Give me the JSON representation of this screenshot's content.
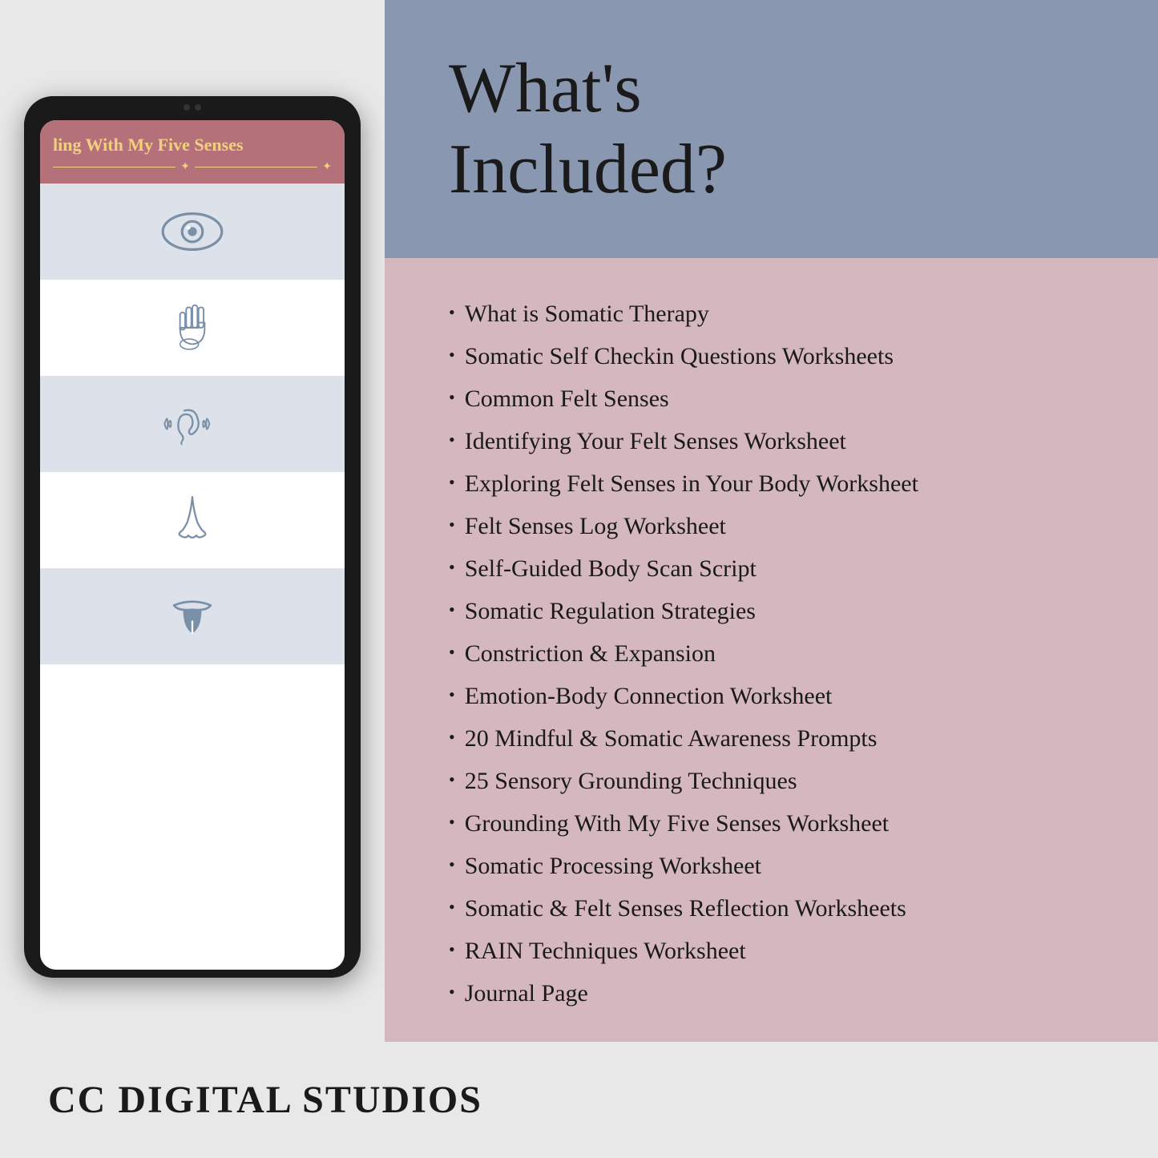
{
  "left": {
    "tablet": {
      "screen_title": "ling With My Five Senses",
      "senses": [
        "eye",
        "hand",
        "ear",
        "nose",
        "tongue"
      ]
    }
  },
  "right": {
    "header": {
      "title_line1": "What's",
      "title_line2": "Included?"
    },
    "items": [
      "What is Somatic Therapy",
      "Somatic Self Checkin Questions Worksheets",
      "Common Felt Senses",
      "Identifying Your Felt Senses Worksheet",
      "Exploring Felt Senses in Your Body Worksheet",
      "Felt Senses Log Worksheet",
      "Self-Guided Body Scan Script",
      "Somatic Regulation Strategies",
      "Constriction & Expansion",
      "Emotion-Body Connection Worksheet",
      "20 Mindful & Somatic Awareness Prompts",
      "25 Sensory Grounding Techniques",
      "Grounding With My Five Senses Worksheet",
      "Somatic Processing Worksheet",
      "Somatic & Felt Senses Reflection Worksheets",
      "RAIN Techniques Worksheet",
      "Journal Page"
    ]
  },
  "footer": {
    "brand": "CC DIGITAL STUDIOS"
  }
}
